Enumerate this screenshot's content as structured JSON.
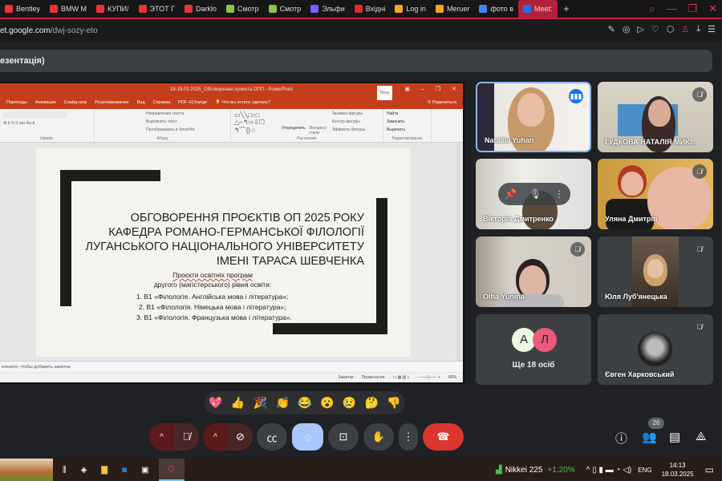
{
  "browser": {
    "tabs": [
      "Bentley",
      "BMW M",
      "КУПИ/",
      "ЭТОТ Г",
      "Darklo",
      "Смотр",
      "Смотр",
      "Эльфи",
      "Вхідні",
      "Log in",
      "Meruer",
      "фото в",
      "Meet:"
    ],
    "tab_colors": [
      "#e33",
      "#e33",
      "#e33",
      "#e33",
      "#e33",
      "#8bc34a",
      "#8bc34a",
      "#7b5cff",
      "#d93025",
      "#f5a623",
      "#f5a623",
      "#4285f4",
      "#1a73e8"
    ],
    "url_host": "et.google.com",
    "url_path": "/dwj-sozy-eto"
  },
  "meet": {
    "title": "езентація)"
  },
  "ppt": {
    "window_title": "18-19.03.2025_Обговорення проекта ОПП  -  PowerPoint",
    "login": "Вход",
    "share": "Поделиться",
    "menu": [
      "Переходы",
      "Анимация",
      "Слайд-шоу",
      "Рецензирование",
      "Вид",
      "Справка",
      "PDF-XChange",
      "Что вы хотите сделать?"
    ],
    "groups": [
      "Шрифт",
      "Абзац",
      "Рисование",
      "Редактирование"
    ],
    "ribbon_items": [
      "Направление текста",
      "Выровнять текст",
      "Преобразовать в SmartArt",
      "Упорядочить",
      "Экспресс-стили",
      "Заливка фигуры",
      "Контур фигуры",
      "Эффекты фигуры",
      "Найти",
      "Заменить",
      "Выделить"
    ],
    "slide": {
      "title_lines": [
        "ОБГОВОРЕННЯ ПРОЄКТІВ ОП 2025 РОКУ",
        "КАФЕДРА РОМАНО-ГЕРМАНСЬКОЇ ФІЛОЛОГІЇ",
        "ЛУГАНСЬКОГО НАЦІОНАЛЬНОГО УНІВЕРСИТЕТУ",
        "ІМЕНІ ТАРАСА ШЕВЧЕНКА"
      ],
      "subtitle": [
        "Проєкти освітніх програм",
        "другого (магістерського) рівня освіти:"
      ],
      "items": [
        "1.   В1 «Філологія. Англійська мова і література»;",
        "2.   В1 «Філологія. Німецька мова і література»;",
        "3.   В1 «Філологія. Французька мова і література»."
      ]
    },
    "notes": "елкните, чтобы добавить заметки",
    "status": {
      "notes": "Заметки",
      "comments": "Примечания",
      "zoom": "80%"
    }
  },
  "participants": [
    {
      "name": "Nataliia Yuhan",
      "speaking": true
    },
    {
      "name": "ГУДКОВА НАТАЛІЯ МИК..."
    },
    {
      "name": "Вікторія Дмитренко"
    },
    {
      "name": "Уляна Дмитрів"
    },
    {
      "name": "Olha Yunina"
    },
    {
      "name": "Юля Луб'янецька"
    },
    {
      "more": "Ще 18 осіб",
      "avatars": [
        "А",
        "Л"
      ]
    },
    {
      "name": "Євген Харковський"
    }
  ],
  "reactions": [
    "💖",
    "👍",
    "🎉",
    "👏",
    "😂",
    "😮",
    "😢",
    "🤔",
    "👎"
  ],
  "people_count": "26",
  "taskbar": {
    "ticker": "Nikkei 225",
    "change": "+1.20%",
    "lang": "ENG",
    "time": "14:13",
    "date": "18.03.2025"
  }
}
